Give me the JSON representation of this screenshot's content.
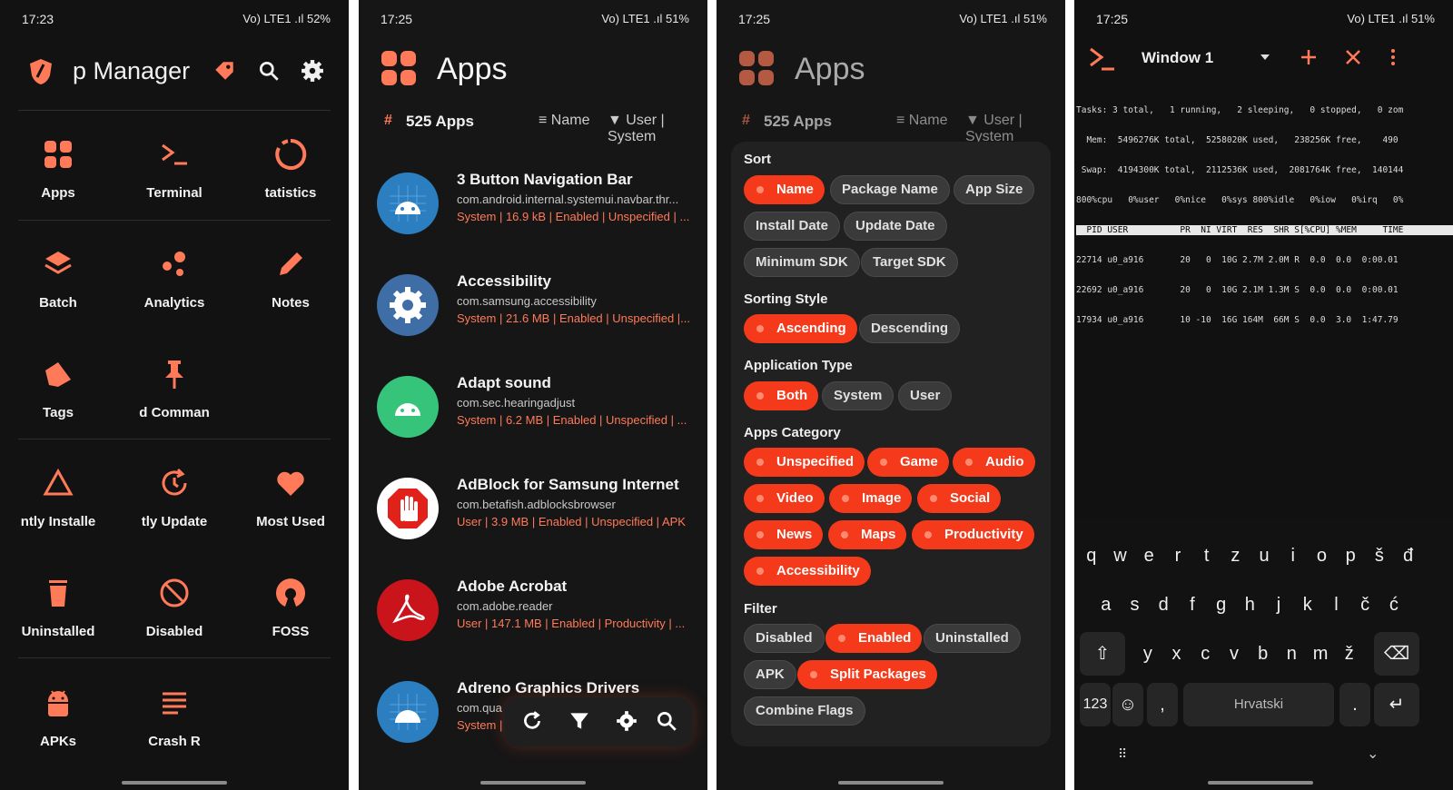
{
  "screen1": {
    "status": {
      "time": "17:23",
      "right": "Vo) LTE1 .ıl 52%"
    },
    "title": "p Manager",
    "tiles": [
      {
        "label": "Apps",
        "icon": "apps-grid-icon"
      },
      {
        "label": "Terminal",
        "icon": "terminal-icon"
      },
      {
        "label": "tatistics",
        "icon": "statistics-ring-icon"
      },
      {
        "label": "Batch",
        "icon": "layers-icon"
      },
      {
        "label": "Analytics",
        "icon": "analytics-dots-icon"
      },
      {
        "label": "Notes",
        "icon": "pencil-icon"
      },
      {
        "label": "Tags",
        "icon": "tags-icon"
      },
      {
        "label": "d Comman",
        "icon": "pin-icon"
      },
      {
        "label": "ntly Installe",
        "icon": "triangle-icon"
      },
      {
        "label": "tly Update",
        "icon": "update-clock-icon"
      },
      {
        "label": "Most Used",
        "icon": "heart-icon"
      },
      {
        "label": "Uninstalled",
        "icon": "trash-icon"
      },
      {
        "label": "Disabled",
        "icon": "block-icon"
      },
      {
        "label": "FOSS",
        "icon": "open-source-icon"
      },
      {
        "label": "APKs",
        "icon": "android-apk-icon"
      },
      {
        "label": "Crash R",
        "icon": "list-lines-icon"
      }
    ]
  },
  "screen2": {
    "status": {
      "time": "17:25",
      "right": "Vo) LTE1 .ıl 51%"
    },
    "title": "Apps",
    "count": "525 Apps",
    "sort_label": "Name",
    "filter_label": "User | System",
    "apps": [
      {
        "name": "3 Button Navigation Bar",
        "package": "com.android.internal.systemui.navbar.thr...",
        "meta": "System | 16.9 kB | Enabled | Unspecified | ...",
        "color": "#2b7fc1"
      },
      {
        "name": "Accessibility",
        "package": "com.samsung.accessibility",
        "meta": "System | 21.6 MB | Enabled | Unspecified |...",
        "color": "#3f6ea6"
      },
      {
        "name": "Adapt sound",
        "package": "com.sec.hearingadjust",
        "meta": "System | 6.2 MB | Enabled | Unspecified | ...",
        "color": "#36c47a"
      },
      {
        "name": "AdBlock for Samsung Internet",
        "package": "com.betafish.adblocksbrowser",
        "meta": "User | 3.9 MB | Enabled | Unspecified | APK",
        "color": "#ffffff"
      },
      {
        "name": "Adobe Acrobat",
        "package": "com.adobe.reader",
        "meta": "User | 147.1 MB | Enabled | Productivity | ...",
        "color": "#c8141a"
      },
      {
        "name": "Adreno Graphics Drivers",
        "package": "com.qua",
        "meta": "System |",
        "color": "#2b7fc1"
      }
    ]
  },
  "screen3": {
    "status": {
      "time": "17:25",
      "right": "Vo) LTE1 .ıl 51%"
    },
    "title": "Apps",
    "count": "525 Apps",
    "sort_label": "Name",
    "filter_label": "User | System",
    "sections": {
      "sort": "Sort",
      "sorting_style": "Sorting Style",
      "app_type": "Application Type",
      "category": "Apps Category",
      "filter": "Filter"
    },
    "chips": {
      "sort": [
        {
          "label": "Name",
          "on": true
        },
        {
          "label": "Package Name",
          "on": false
        },
        {
          "label": "App Size",
          "on": false
        },
        {
          "label": "Install Date",
          "on": false
        },
        {
          "label": "Update Date",
          "on": false
        },
        {
          "label": "Minimum SDK",
          "on": false
        },
        {
          "label": "Target SDK",
          "on": false
        }
      ],
      "style": [
        {
          "label": "Ascending",
          "on": true
        },
        {
          "label": "Descending",
          "on": false
        }
      ],
      "type": [
        {
          "label": "Both",
          "on": true
        },
        {
          "label": "System",
          "on": false
        },
        {
          "label": "User",
          "on": false
        }
      ],
      "category": [
        {
          "label": "Unspecified",
          "on": true
        },
        {
          "label": "Game",
          "on": true
        },
        {
          "label": "Audio",
          "on": true
        },
        {
          "label": "Video",
          "on": true
        },
        {
          "label": "Image",
          "on": true
        },
        {
          "label": "Social",
          "on": true
        },
        {
          "label": "News",
          "on": true
        },
        {
          "label": "Maps",
          "on": true
        },
        {
          "label": "Productivity",
          "on": true
        },
        {
          "label": "Accessibility",
          "on": true
        }
      ],
      "filter": [
        {
          "label": "Disabled",
          "on": false
        },
        {
          "label": "Enabled",
          "on": true
        },
        {
          "label": "Uninstalled",
          "on": false
        },
        {
          "label": "APK",
          "on": false
        },
        {
          "label": "Split Packages",
          "on": true
        },
        {
          "label": "Combine Flags",
          "on": false
        }
      ]
    }
  },
  "screen4": {
    "status": {
      "time": "17:25",
      "right": "Vo) LTE1 .ıl 51%"
    },
    "window": "Window 1",
    "terminal_lines": [
      "Tasks: 3 total,   1 running,   2 sleeping,   0 stopped,   0 zom",
      "  Mem:  5496276K total,  5258020K used,   238256K free,    490",
      " Swap:  4194300K total,  2112536K used,  2081764K free,  140144",
      "800%cpu   0%user   0%nice   0%sys 800%idle   0%iow   0%irq   0%",
      "  PID USER          PR  NI VIRT  RES  SHR S[%CPU] %MEM     TIME",
      "22714 u0_a916       20   0  10G 2.7M 2.0M R  0.0  0.0  0:00.01",
      "22692 u0_a916       20   0  10G 2.1M 1.3M S  0.0  0.0  0:00.01",
      "17934 u0_a916       10 -10  16G 164M  66M S  0.0  3.0  1:47.79"
    ],
    "keyboard": {
      "row1": [
        "q",
        "w",
        "e",
        "r",
        "t",
        "z",
        "u",
        "i",
        "o",
        "p",
        "š",
        "đ"
      ],
      "row2": [
        "a",
        "s",
        "d",
        "f",
        "g",
        "h",
        "j",
        "k",
        "l",
        "č",
        "ć"
      ],
      "row3": [
        "y",
        "x",
        "c",
        "v",
        "b",
        "n",
        "m",
        "ž"
      ],
      "num_key": "123",
      "space": "Hrvatski",
      "comma": ",",
      "period": "."
    }
  }
}
